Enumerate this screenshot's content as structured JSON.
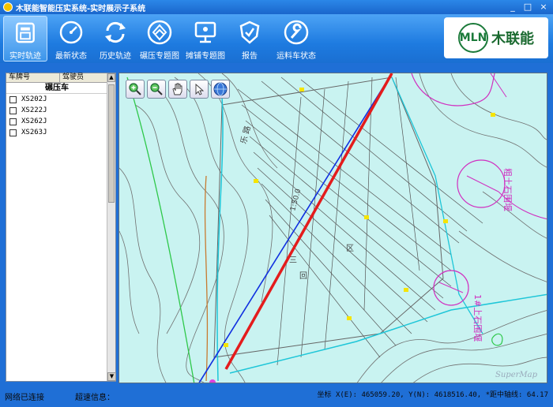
{
  "window": {
    "title": "木联能智能压实系统-实时展示子系统",
    "controls": [
      "_",
      "□",
      "×"
    ]
  },
  "toolbar": {
    "items": [
      {
        "label": "实时轨迹",
        "icon": "realtime-track-icon",
        "active": true
      },
      {
        "label": "最新状态",
        "icon": "gauge-icon",
        "active": false
      },
      {
        "label": "历史轨迹",
        "icon": "refresh-icon",
        "active": false
      },
      {
        "label": "碾压专题图",
        "icon": "layers-icon",
        "active": false
      },
      {
        "label": "摊铺专题图",
        "icon": "monitor-icon",
        "active": false
      },
      {
        "label": "报告",
        "icon": "shield-icon",
        "active": false
      },
      {
        "label": "运料车状态",
        "icon": "wrench-icon",
        "active": false
      }
    ],
    "logo": {
      "mark": "MLN",
      "text": "木联能"
    }
  },
  "vehicle_panel": {
    "headers": [
      "车牌号",
      "驾驶员"
    ],
    "group": "碾压车",
    "vehicles": [
      {
        "plate": "XS202J",
        "checked": false
      },
      {
        "plate": "XS222J",
        "checked": false
      },
      {
        "plate": "XS262J",
        "checked": false
      },
      {
        "plate": "XS263J",
        "checked": false
      }
    ]
  },
  "map": {
    "labels": {
      "area1": "粗土石围堰",
      "area2": "1#上石围堰",
      "elev": "1:50.0",
      "road": "乐  路",
      "v1": "区",
      "v2": "回",
      "v3": "三"
    },
    "watermark": "SuperMap"
  },
  "statusbar": {
    "connection": "网络已连接",
    "speed_label": "超速信息：",
    "coord_label": "坐标",
    "x_label": "X(E):",
    "x_value": "465059.20",
    "y_label": "Y(N):",
    "y_value": "4618516.40",
    "dist_label": "*距中轴线:",
    "dist_value": "64.17"
  }
}
